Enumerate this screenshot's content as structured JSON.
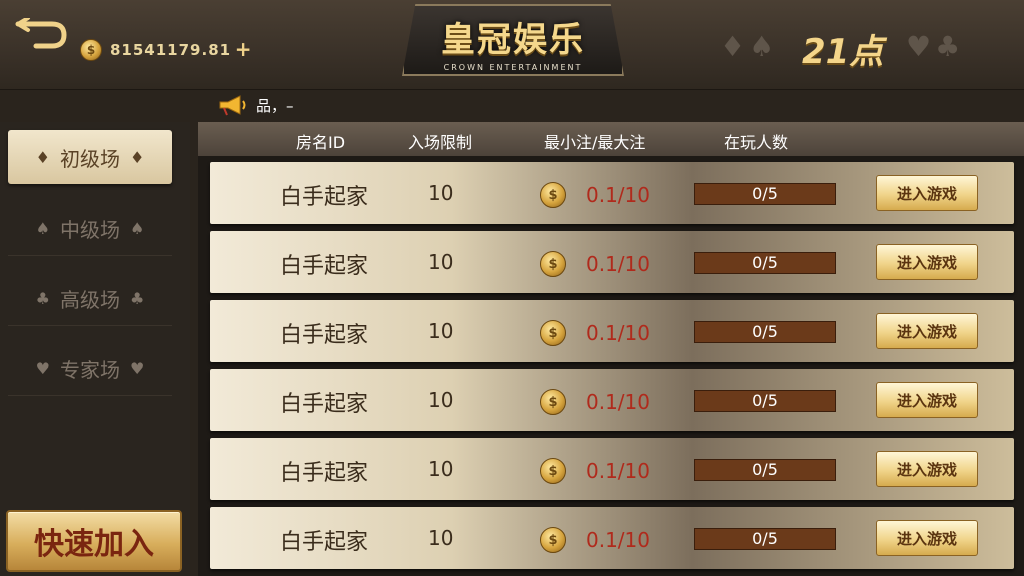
{
  "header": {
    "balance": "81541179.81",
    "coin_glyph": "$",
    "plus_label": "+",
    "logo_title": "皇冠娱乐",
    "logo_subtitle": "CROWN ENTERTAINMENT",
    "game_title": "21点",
    "suits_left": "♦♠",
    "suits_right": "♥♣",
    "notice_text": "品，–"
  },
  "sidebar": {
    "tabs": [
      {
        "label": "初级场",
        "suit": "♦",
        "active": true
      },
      {
        "label": "中级场",
        "suit": "♠",
        "active": false
      },
      {
        "label": "高级场",
        "suit": "♣",
        "active": false
      },
      {
        "label": "专家场",
        "suit": "♥",
        "active": false
      }
    ],
    "quick_join": "快速加入"
  },
  "table": {
    "columns": {
      "room_id": "房名ID",
      "entry_limit": "入场限制",
      "bet_range": "最小注/最大注",
      "players": "在玩人数"
    },
    "rows": [
      {
        "name": "白手起家",
        "limit": "10",
        "bet": "0.1/10",
        "players": "0/5",
        "button": "进入游戏"
      },
      {
        "name": "白手起家",
        "limit": "10",
        "bet": "0.1/10",
        "players": "0/5",
        "button": "进入游戏"
      },
      {
        "name": "白手起家",
        "limit": "10",
        "bet": "0.1/10",
        "players": "0/5",
        "button": "进入游戏"
      },
      {
        "name": "白手起家",
        "limit": "10",
        "bet": "0.1/10",
        "players": "0/5",
        "button": "进入游戏"
      },
      {
        "name": "白手起家",
        "limit": "10",
        "bet": "0.1/10",
        "players": "0/5",
        "button": "进入游戏"
      },
      {
        "name": "白手起家",
        "limit": "10",
        "bet": "0.1/10",
        "players": "0/5",
        "button": "进入游戏"
      }
    ]
  },
  "icons": {
    "back": "back-arrow-icon",
    "coin": "coin-icon",
    "horn": "megaphone-icon"
  },
  "colors": {
    "gold": "#f4d58a",
    "bet_red": "#b02a1c",
    "players_bar": "#6b3a1a",
    "quick_join_text": "#7a2510"
  }
}
